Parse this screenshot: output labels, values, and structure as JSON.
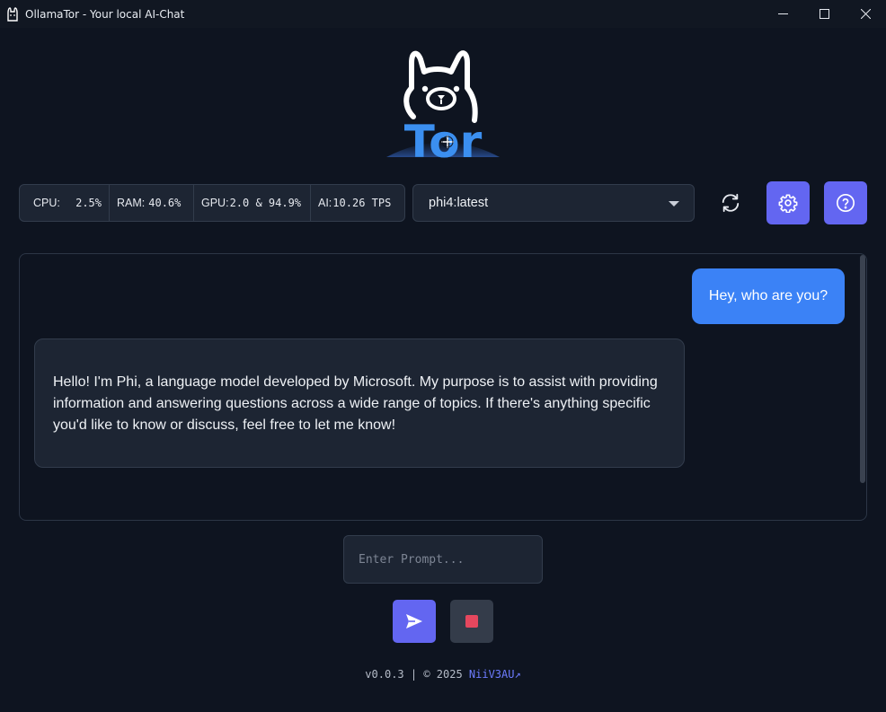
{
  "window": {
    "title": "OllamaTor - Your local AI-Chat",
    "controls": [
      "minimize-icon",
      "maximize-icon",
      "close-icon"
    ]
  },
  "logo": {
    "text": "Tor",
    "accent": "#3b8ff0"
  },
  "stats": {
    "cpu_label": "CPU:",
    "cpu_value": "2.5%",
    "ram_label": "RAM:",
    "ram_value": "40.6%",
    "gpu_label": "GPU:",
    "gpu_value": "2.0 & 94.9%",
    "ai_label": "AI:",
    "ai_value": "10.26 TPS"
  },
  "model_select": {
    "selected": "phi4:latest"
  },
  "toolbar": {
    "refresh_icon": "refresh-icon",
    "settings_icon": "gear-icon",
    "help_icon": "help-icon"
  },
  "chat": {
    "messages": [
      {
        "role": "user",
        "text": "Hey, who are you?"
      },
      {
        "role": "assistant",
        "text": "Hello! I'm Phi, a language model developed by Microsoft. My purpose is to assist with providing information and answering questions across a wide range of topics. If there's anything specific you'd like to know or discuss, feel free to let me know!"
      }
    ]
  },
  "prompt": {
    "placeholder": "Enter Prompt...",
    "value": ""
  },
  "controls": {
    "send_icon": "send-icon",
    "stop_icon": "stop-icon"
  },
  "footer": {
    "version_text": "v0.0.3 | © 2025",
    "author_link": "NiiV3AU↗"
  },
  "colors": {
    "background": "#0e1420",
    "panel": "#1d2533",
    "accent": "#6366f1",
    "user_bubble": "#3b82f6",
    "stop": "#e5475e"
  }
}
